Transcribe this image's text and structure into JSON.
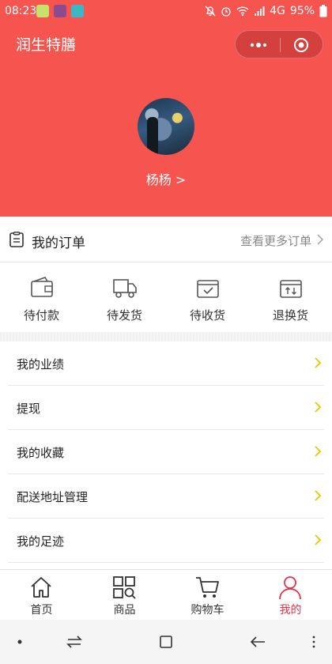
{
  "status_bar": {
    "time": "08:23",
    "network": "4G",
    "battery": "95%"
  },
  "header": {
    "title": "润生特膳",
    "background_color": "#f5544f"
  },
  "profile": {
    "username": "杨杨 >"
  },
  "orders": {
    "title": "我的订单",
    "more": "查看更多订单",
    "items": [
      {
        "label": "待付款",
        "icon": "wallet-icon"
      },
      {
        "label": "待发货",
        "icon": "truck-icon"
      },
      {
        "label": "待收货",
        "icon": "box-check-icon"
      },
      {
        "label": "退换货",
        "icon": "box-return-icon"
      }
    ]
  },
  "menu": [
    {
      "label": "我的业绩"
    },
    {
      "label": "提现"
    },
    {
      "label": "我的收藏"
    },
    {
      "label": "配送地址管理"
    },
    {
      "label": "我的足迹"
    }
  ],
  "tabs": [
    {
      "label": "首页",
      "icon": "home-icon",
      "active": false
    },
    {
      "label": "商品",
      "icon": "grid-search-icon",
      "active": false
    },
    {
      "label": "购物车",
      "icon": "cart-icon",
      "active": false
    },
    {
      "label": "我的",
      "icon": "user-icon",
      "active": true
    }
  ],
  "colors": {
    "accent": "#e8314b",
    "arrow": "#f2c200"
  }
}
